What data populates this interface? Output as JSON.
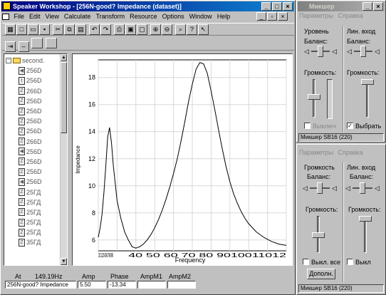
{
  "main_window": {
    "title": "Speaker Workshop - [256N-good? Impedance (dataset)]",
    "menu": [
      "File",
      "Edit",
      "View",
      "Calculate",
      "Transform",
      "Resource",
      "Options",
      "Window",
      "Help"
    ],
    "toolbar_icons": [
      "properties-icon",
      "new-icon",
      "open-icon",
      "save-icon",
      "cut-icon",
      "copy-icon",
      "paste-icon",
      "undo-icon",
      "redo-icon",
      "print-icon",
      "view1-icon",
      "view2-icon",
      "zoom-in-icon",
      "zoom-out-icon",
      "find-icon",
      "help-icon",
      "context-help-icon"
    ],
    "tree": {
      "root": "second.",
      "items": [
        "256D",
        "256D",
        "266D",
        "256D",
        "256D",
        "256D",
        "256D",
        "266D",
        "256D",
        "256D",
        "256D",
        "256D",
        "25ГД",
        "25ГД",
        "25ГД",
        "25ГД",
        "25ГД",
        "35ГД"
      ],
      "item_icons": [
        "speaker",
        "text",
        "z",
        "z",
        "z",
        "z",
        "z",
        "z",
        "speaker",
        "z",
        "z",
        "speaker",
        "z",
        "z",
        "z",
        "z",
        "z",
        "z"
      ]
    },
    "status": {
      "headers": [
        "At",
        "Amp",
        "Phase",
        "AmpM1",
        "AmpM2"
      ],
      "at_value": "149.19Hz",
      "name_value": "256N-good? Impedance",
      "amp_value": "5.50",
      "phase_value": "-13.34",
      "ampm1_value": "",
      "ampm2_value": ""
    }
  },
  "chart_data": {
    "type": "line",
    "xlabel": "Frequency",
    "ylabel": "Impedance",
    "y_ticks": [
      "18",
      "16",
      "14",
      "12",
      "10",
      "8",
      "6"
    ],
    "x_ticks": [
      "20",
      "30",
      "40",
      "50",
      "60",
      "70",
      "80",
      "90",
      "100",
      "110",
      "120"
    ],
    "x_tick_label_text": "2012345678890",
    "x_tick_label_text_right": "40  50  60  70  80  9010011012",
    "ylim": [
      5.2,
      19.3
    ],
    "grid": true,
    "series": [
      {
        "x": [
          20,
          21,
          22,
          23,
          24,
          25,
          26,
          27,
          28,
          30,
          32,
          34,
          36,
          38,
          40,
          42,
          44,
          46,
          48,
          50,
          52,
          54,
          56,
          58,
          60,
          62,
          64,
          66,
          68,
          70,
          72,
          74,
          76,
          78,
          80,
          82,
          84,
          86,
          88,
          90,
          92,
          94,
          96,
          98,
          100,
          104,
          108,
          112,
          116,
          120
        ],
        "y": [
          6.2,
          6.9,
          7.9,
          9.5,
          11.5,
          13.6,
          14.3,
          13.2,
          11.5,
          8.9,
          7.6,
          6.6,
          6.0,
          5.5,
          5.4,
          5.5,
          5.7,
          6.0,
          6.4,
          6.9,
          7.5,
          8.2,
          9.0,
          9.9,
          10.9,
          12.0,
          13.3,
          14.7,
          16.2,
          17.5,
          18.6,
          19.1,
          19.0,
          18.3,
          17.0,
          15.6,
          14.1,
          12.7,
          11.4,
          10.3,
          9.4,
          8.7,
          8.1,
          7.6,
          7.2,
          6.6,
          6.2,
          5.9,
          5.7,
          5.6
        ]
      }
    ]
  },
  "mixer_top": {
    "title": "Микшер",
    "menu": [
      "Параметры",
      "Справка"
    ],
    "col1": {
      "title": "Уровень",
      "balance": "Баланс:",
      "volume": "Громкость:",
      "check": "Выключ",
      "check_state": ""
    },
    "col2": {
      "title": "Лин. вход",
      "balance": "Баланс:",
      "volume": "Громкость:",
      "check": "Выбрать",
      "check_state": "✓"
    },
    "status": "Микшер SB16 (220)"
  },
  "mixer_bottom": {
    "menu": [
      "Параметры",
      "Справка"
    ],
    "col1": {
      "title": "Громкость",
      "balance": "Баланс:",
      "volume": "Громкость:",
      "check": "Выкл. все",
      "check_state": ""
    },
    "col2": {
      "title": "Лин. вход",
      "balance": "Баланс:",
      "volume": "Громкость:",
      "check": "Выкл",
      "check_state": ""
    },
    "button": "Дополн.",
    "status": "Микшер SB16 (220)"
  }
}
